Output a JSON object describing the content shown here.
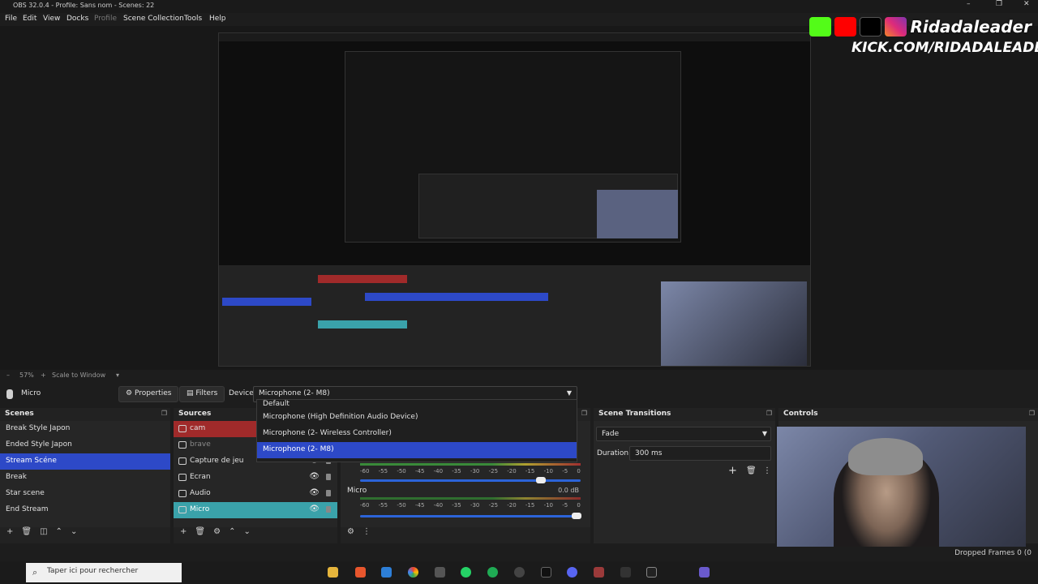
{
  "window": {
    "title": "OBS 32.0.4 - Profile: Sans nom - Scenes: 22",
    "controls": [
      "–",
      "❐",
      "✕"
    ]
  },
  "menu": [
    "File",
    "Edit",
    "View",
    "Docks",
    "Profile",
    "Scene Collection",
    "Tools",
    "Help"
  ],
  "overlay": {
    "handle": "Ridadaleader",
    "kick_url": "KICK.COM/RIDADALEADER"
  },
  "preview_bar": {
    "zoom": "57%",
    "scale_label": "Scale to Window"
  },
  "source_bar": {
    "selected_source": "Micro",
    "properties_label": "Properties",
    "filters_label": "Filters",
    "device_label": "Device",
    "device_value": "Microphone (2- M8)"
  },
  "device_dropdown": {
    "options": [
      "Default",
      "Microphone (High Definition Audio Device)",
      "Microphone (2- Wireless Controller)",
      "Microphone (2- M8)"
    ],
    "selected": "Microphone (2- M8)"
  },
  "scenes": {
    "title": "Scenes",
    "items": [
      "Break Style Japon",
      "Ended Style Japon",
      "Stream Scéne",
      "Break",
      "Star scene",
      "End Stream"
    ],
    "selected": "Stream Scéne"
  },
  "sources": {
    "title": "Sources",
    "items": [
      "cam",
      "brave",
      "Capture de jeu",
      "Ecran",
      "Audio",
      "Micro"
    ]
  },
  "mixer": {
    "scale": [
      "-60",
      "-55",
      "-50",
      "-45",
      "-40",
      "-35",
      "-30",
      "-25",
      "-20",
      "-15",
      "-10",
      "-5",
      "0"
    ],
    "channels": [
      {
        "name": "",
        "db": "",
        "volume": 0.82
      },
      {
        "name": "Micro",
        "db": "0.0 dB",
        "volume": 0.98
      }
    ]
  },
  "transitions": {
    "title": "Scene Transitions",
    "value": "Fade",
    "duration_label": "Duration",
    "duration_value": "300 ms"
  },
  "controls": {
    "title": "Controls"
  },
  "status": {
    "dropped_frames": "Dropped Frames 0 (0"
  },
  "taskbar": {
    "search_placeholder": "Taper ici pour rechercher"
  },
  "colors": {
    "accent": "#2d49c7",
    "source_red": "#a02a2a",
    "source_teal": "#3aa2aa"
  }
}
